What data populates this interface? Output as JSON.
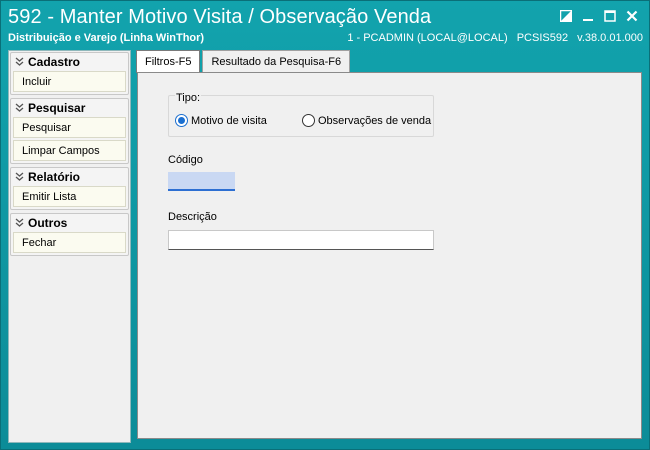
{
  "window": {
    "title": "592 - Manter Motivo Visita / Observação Venda",
    "subtitle": "Distribuição e Varejo (Linha WinThor)",
    "status_user": "1 - PCADMIN (LOCAL@LOCAL)",
    "status_program": "PCSIS592",
    "status_version": "v.38.0.01.000"
  },
  "sidebar": {
    "groups": [
      {
        "title": "Cadastro",
        "items": [
          "Incluir"
        ]
      },
      {
        "title": "Pesquisar",
        "items": [
          "Pesquisar",
          "Limpar Campos"
        ]
      },
      {
        "title": "Relatório",
        "items": [
          "Emitir Lista"
        ]
      },
      {
        "title": "Outros",
        "items": [
          "Fechar"
        ]
      }
    ]
  },
  "tabs": [
    "Filtros-F5",
    "Resultado da Pesquisa-F6"
  ],
  "form": {
    "tipo_label": "Tipo:",
    "radio_motivo": "Motivo de visita",
    "radio_observacoes": "Observações de venda",
    "selected": "Motivo de visita",
    "codigo_label": "Código",
    "codigo_value": "",
    "descricao_label": "Descrição",
    "descricao_value": ""
  },
  "colors": {
    "title_bar": "#12a3ad",
    "accent": "#1b6fd0",
    "codigo_field": "#c9d8f3"
  }
}
